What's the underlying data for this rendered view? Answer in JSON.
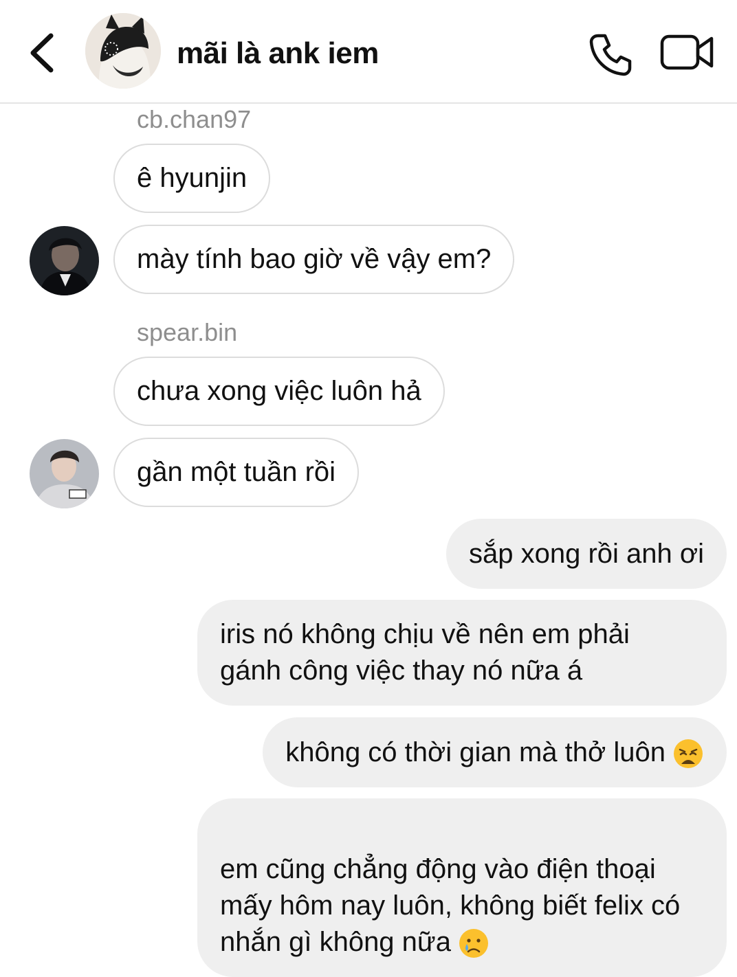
{
  "header": {
    "title": "mãi là ank iem",
    "back_icon": "chevron-left-icon",
    "call_icon": "phone-icon",
    "video_icon": "video-camera-icon"
  },
  "messages": [
    {
      "id": "m1",
      "sender": "cb.chan97",
      "direction": "incoming",
      "text": "ê hyunjin"
    },
    {
      "id": "m2",
      "sender": "cb.chan97",
      "direction": "incoming",
      "text": "mày tính bao giờ về vậy em?"
    },
    {
      "id": "m3",
      "sender": "spear.bin",
      "direction": "incoming",
      "text": "chưa xong việc luôn hả"
    },
    {
      "id": "m4",
      "sender": "spear.bin",
      "direction": "incoming",
      "text": "gần một tuần rồi"
    },
    {
      "id": "m5",
      "direction": "outgoing",
      "text": "sắp xong rồi anh ơi"
    },
    {
      "id": "m6",
      "direction": "outgoing",
      "text": "iris nó không chịu về nên em phải\ngánh công việc thay nó nữa á"
    },
    {
      "id": "m7",
      "direction": "outgoing",
      "text": "không có thời gian mà thở luôn",
      "emoji": "weary-face-emoji"
    },
    {
      "id": "m8",
      "direction": "outgoing",
      "text": "em cũng chẳng động vào điện thoại\nmấy hôm nay luôn, không biết felix có\nnhắn gì không nữa",
      "emoji": "crying-face-emoji"
    }
  ],
  "colors": {
    "incoming_border": "#dcdcdc",
    "outgoing_bg": "#efefef",
    "sender_name": "#8e8e8e",
    "emoji_yellow": "#fbc02d",
    "tear_blue": "#5aa9e6"
  }
}
